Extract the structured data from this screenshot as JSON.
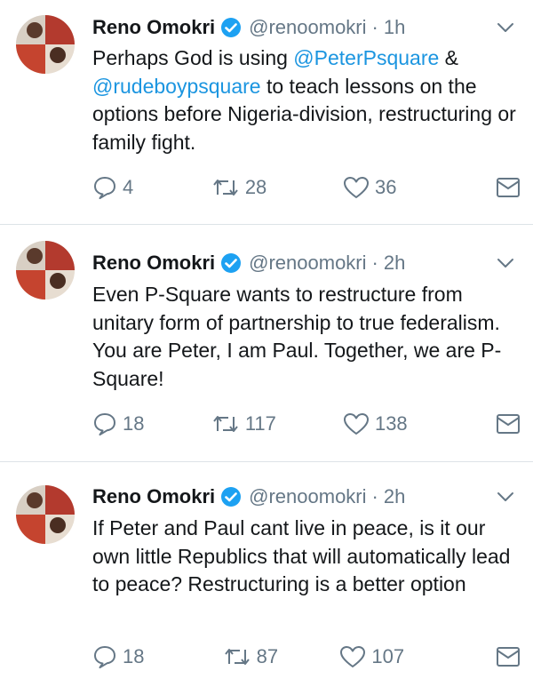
{
  "tweets": [
    {
      "name": "Reno Omokri",
      "handle": "@renoomokri",
      "time": "1h",
      "text_before": "Perhaps God is using ",
      "mention_1": "@PeterPsquare",
      "text_mid": " & ",
      "mention_2": "@rudeboypsquare",
      "text_after": " to teach lessons on the options before Nigeria-division, restructuring or family fight.",
      "replies": "4",
      "retweets": "28",
      "likes": "36"
    },
    {
      "name": "Reno Omokri",
      "handle": "@renoomokri",
      "time": "2h",
      "text": "Even P-Square wants to restructure from unitary form of partnership to true federalism. You are Peter, I am Paul. Together, we are P-Square!",
      "replies": "18",
      "retweets": "117",
      "likes": "138"
    },
    {
      "name": "Reno Omokri",
      "handle": "@renoomokri",
      "time": "2h",
      "text": "If Peter and Paul cant live in peace, is it our own little Republics that will automatically lead to peace? Restructuring is a better option",
      "replies": "18",
      "retweets": "87",
      "likes": "107"
    }
  ],
  "colors": {
    "mention": "#1b95e0",
    "verified": "#1da1f2",
    "secondary_text": "#657786",
    "divider": "#dde3e7"
  },
  "icons": [
    "verified-badge-icon",
    "chevron-down-icon",
    "reply-icon",
    "retweet-icon",
    "like-icon",
    "direct-message-icon"
  ]
}
